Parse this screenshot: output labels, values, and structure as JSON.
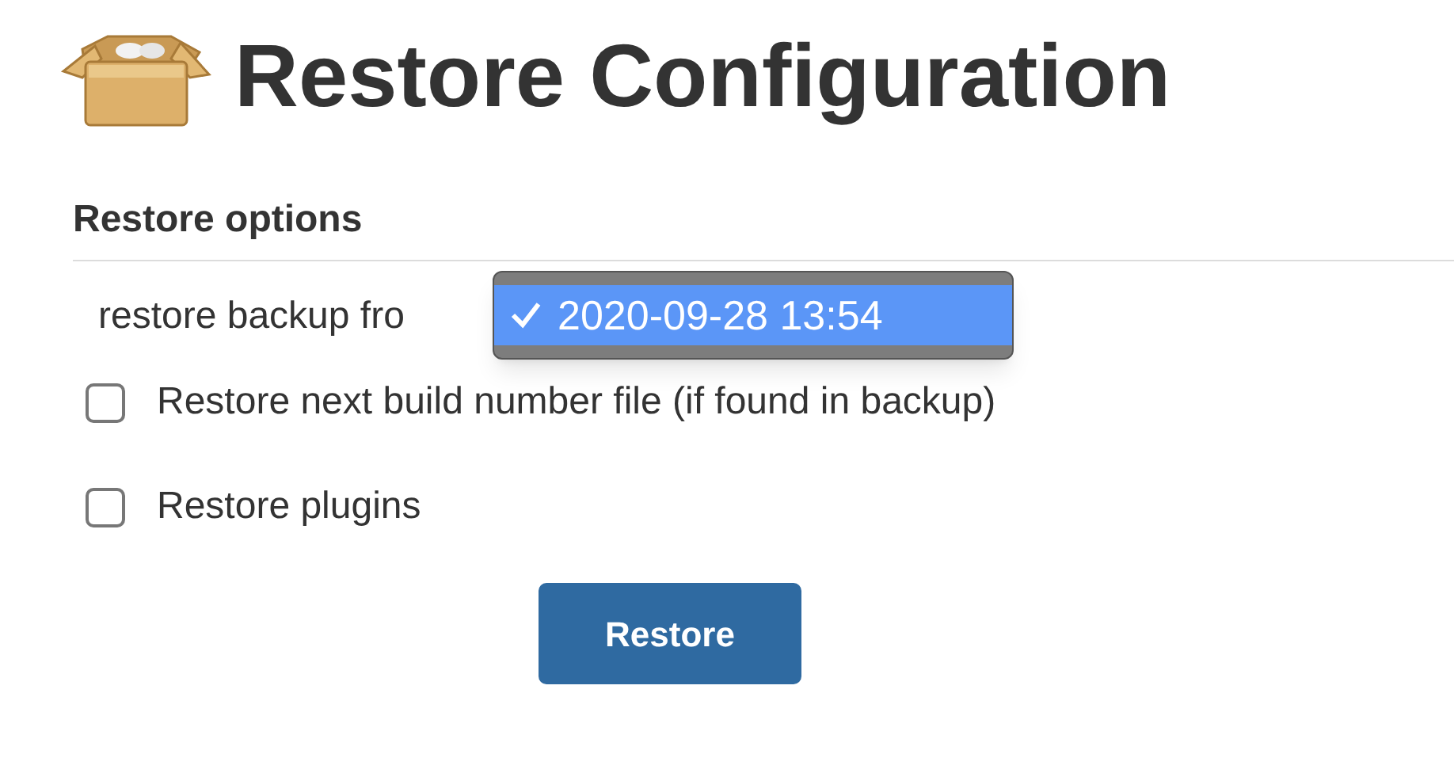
{
  "title": "Restore Configuration",
  "section": {
    "heading": "Restore options"
  },
  "backup_select": {
    "label": "restore backup fro",
    "expanded": true,
    "options": [
      {
        "label": "2020-09-28 13:54",
        "selected": true
      }
    ]
  },
  "checkboxes": [
    {
      "label": "Restore next build number file (if found in backup)",
      "checked": false
    },
    {
      "label": "Restore plugins",
      "checked": false
    }
  ],
  "button": "Restore"
}
